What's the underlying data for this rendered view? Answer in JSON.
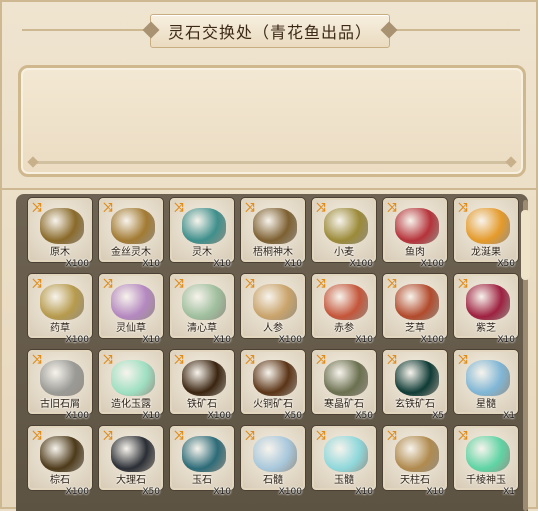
{
  "title": "灵石交换处（青花鱼出品）",
  "colors": {
    "accent": "#e38a14",
    "panel": "#6e6352",
    "bg": "#e9ddc6"
  },
  "items": [
    {
      "name": "原木",
      "qty": "X100",
      "art": "logs-brown",
      "color": "#8a6a2a"
    },
    {
      "name": "金丝灵木",
      "qty": "X10",
      "art": "logs-gold",
      "color": "#a27a32"
    },
    {
      "name": "灵木",
      "qty": "X10",
      "art": "logs-teal",
      "color": "#3e8f8c"
    },
    {
      "name": "梧桐神木",
      "qty": "X10",
      "art": "logs-brown",
      "color": "#7d6031"
    },
    {
      "name": "小麦",
      "qty": "X100",
      "art": "wheat-sack",
      "color": "#9b8a38"
    },
    {
      "name": "鱼肉",
      "qty": "X100",
      "art": "meat",
      "color": "#b5323a"
    },
    {
      "name": "龙涎果",
      "qty": "X50",
      "art": "berries",
      "color": "#e59a2a"
    },
    {
      "name": "药草",
      "qty": "X100",
      "art": "herb-bundle",
      "color": "#b69a4c"
    },
    {
      "name": "灵仙草",
      "qty": "X10",
      "art": "flower-purple",
      "color": "#b488c0"
    },
    {
      "name": "清心草",
      "qty": "X10",
      "art": "flower-white",
      "color": "#9fbf9e"
    },
    {
      "name": "人参",
      "qty": "X100",
      "art": "ginseng",
      "color": "#c9a36a"
    },
    {
      "name": "赤参",
      "qty": "X10",
      "art": "ginseng-red",
      "color": "#c4553a"
    },
    {
      "name": "芝草",
      "qty": "X100",
      "art": "mushroom-red",
      "color": "#b24a2c"
    },
    {
      "name": "紫芝",
      "qty": "X10",
      "art": "mushroom-purple",
      "color": "#9e2041"
    },
    {
      "name": "古旧石屑",
      "qty": "X100",
      "art": "stone-blocks",
      "color": "#9a9a96"
    },
    {
      "name": "造化玉露",
      "qty": "X10",
      "art": "jade-ore",
      "color": "#9fe0c2"
    },
    {
      "name": "铁矿石",
      "qty": "X100",
      "art": "ore-dark",
      "color": "#3a2410"
    },
    {
      "name": "火铜矿石",
      "qty": "X50",
      "art": "ore-copper",
      "color": "#5b3416"
    },
    {
      "name": "寒晶矿石",
      "qty": "X50",
      "art": "ore-green",
      "color": "#6b7050"
    },
    {
      "name": "玄铁矿石",
      "qty": "X5",
      "art": "ore-teal",
      "color": "#0f3b36"
    },
    {
      "name": "星髓",
      "qty": "X1",
      "art": "crystal-stone",
      "color": "#7fb6d6"
    },
    {
      "name": "棕石",
      "qty": "X100",
      "art": "brick-brown",
      "color": "#4d3a1a"
    },
    {
      "name": "大理石",
      "qty": "X50",
      "art": "brick-dark",
      "color": "#2a2e35"
    },
    {
      "name": "玉石",
      "qty": "X10",
      "art": "brick-teal",
      "color": "#2c6b78"
    },
    {
      "name": "石髓",
      "qty": "X100",
      "art": "crystal-blue",
      "color": "#a8c8dc"
    },
    {
      "name": "玉髓",
      "qty": "X10",
      "art": "crystal-cyan",
      "color": "#8fd8dc"
    },
    {
      "name": "天柱石",
      "qty": "X10",
      "art": "rock-gold",
      "color": "#b08a4e"
    },
    {
      "name": "千棱神玉",
      "qty": "X1",
      "art": "crystal-green",
      "color": "#5fd4a4"
    }
  ],
  "swap_icon": "⤨"
}
